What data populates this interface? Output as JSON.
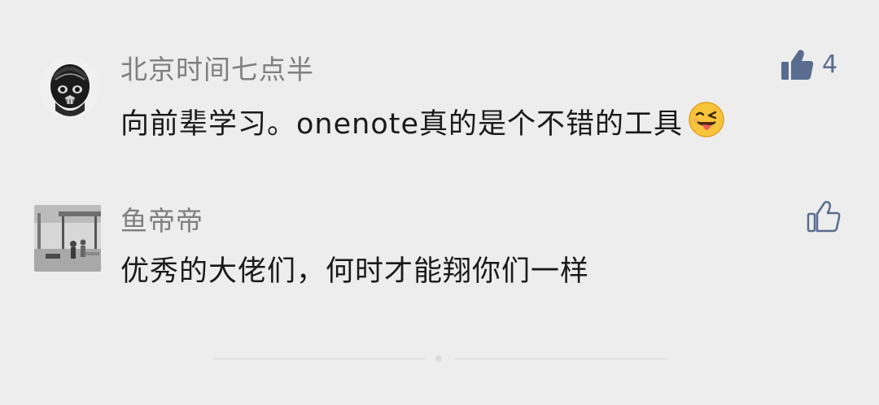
{
  "comments": [
    {
      "author": "北京时间七点半",
      "text": "向前辈学习。onenote真的是个不错的工具",
      "emoji": "wink-tongue-emoji",
      "likes": "4",
      "liked": true
    },
    {
      "author": "鱼帝帝",
      "text": "优秀的大佬们，何时才能翔你们一样",
      "likes": "",
      "liked": false
    }
  ],
  "colors": {
    "background": "#ededed",
    "like_filled": "#5a6c8f",
    "like_outline": "#5a6c8f",
    "nickname": "#7f7f7f",
    "text": "#1a1a1a"
  }
}
